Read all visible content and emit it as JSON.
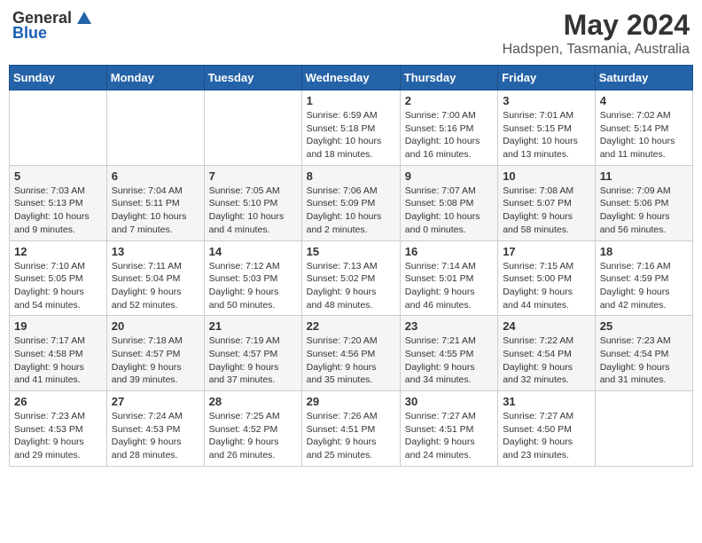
{
  "logo": {
    "general": "General",
    "blue": "Blue"
  },
  "title": {
    "month_year": "May 2024",
    "location": "Hadspen, Tasmania, Australia"
  },
  "weekdays": [
    "Sunday",
    "Monday",
    "Tuesday",
    "Wednesday",
    "Thursday",
    "Friday",
    "Saturday"
  ],
  "weeks": [
    [
      {
        "day": "",
        "info": ""
      },
      {
        "day": "",
        "info": ""
      },
      {
        "day": "",
        "info": ""
      },
      {
        "day": "1",
        "info": "Sunrise: 6:59 AM\nSunset: 5:18 PM\nDaylight: 10 hours\nand 18 minutes."
      },
      {
        "day": "2",
        "info": "Sunrise: 7:00 AM\nSunset: 5:16 PM\nDaylight: 10 hours\nand 16 minutes."
      },
      {
        "day": "3",
        "info": "Sunrise: 7:01 AM\nSunset: 5:15 PM\nDaylight: 10 hours\nand 13 minutes."
      },
      {
        "day": "4",
        "info": "Sunrise: 7:02 AM\nSunset: 5:14 PM\nDaylight: 10 hours\nand 11 minutes."
      }
    ],
    [
      {
        "day": "5",
        "info": "Sunrise: 7:03 AM\nSunset: 5:13 PM\nDaylight: 10 hours\nand 9 minutes."
      },
      {
        "day": "6",
        "info": "Sunrise: 7:04 AM\nSunset: 5:11 PM\nDaylight: 10 hours\nand 7 minutes."
      },
      {
        "day": "7",
        "info": "Sunrise: 7:05 AM\nSunset: 5:10 PM\nDaylight: 10 hours\nand 4 minutes."
      },
      {
        "day": "8",
        "info": "Sunrise: 7:06 AM\nSunset: 5:09 PM\nDaylight: 10 hours\nand 2 minutes."
      },
      {
        "day": "9",
        "info": "Sunrise: 7:07 AM\nSunset: 5:08 PM\nDaylight: 10 hours\nand 0 minutes."
      },
      {
        "day": "10",
        "info": "Sunrise: 7:08 AM\nSunset: 5:07 PM\nDaylight: 9 hours\nand 58 minutes."
      },
      {
        "day": "11",
        "info": "Sunrise: 7:09 AM\nSunset: 5:06 PM\nDaylight: 9 hours\nand 56 minutes."
      }
    ],
    [
      {
        "day": "12",
        "info": "Sunrise: 7:10 AM\nSunset: 5:05 PM\nDaylight: 9 hours\nand 54 minutes."
      },
      {
        "day": "13",
        "info": "Sunrise: 7:11 AM\nSunset: 5:04 PM\nDaylight: 9 hours\nand 52 minutes."
      },
      {
        "day": "14",
        "info": "Sunrise: 7:12 AM\nSunset: 5:03 PM\nDaylight: 9 hours\nand 50 minutes."
      },
      {
        "day": "15",
        "info": "Sunrise: 7:13 AM\nSunset: 5:02 PM\nDaylight: 9 hours\nand 48 minutes."
      },
      {
        "day": "16",
        "info": "Sunrise: 7:14 AM\nSunset: 5:01 PM\nDaylight: 9 hours\nand 46 minutes."
      },
      {
        "day": "17",
        "info": "Sunrise: 7:15 AM\nSunset: 5:00 PM\nDaylight: 9 hours\nand 44 minutes."
      },
      {
        "day": "18",
        "info": "Sunrise: 7:16 AM\nSunset: 4:59 PM\nDaylight: 9 hours\nand 42 minutes."
      }
    ],
    [
      {
        "day": "19",
        "info": "Sunrise: 7:17 AM\nSunset: 4:58 PM\nDaylight: 9 hours\nand 41 minutes."
      },
      {
        "day": "20",
        "info": "Sunrise: 7:18 AM\nSunset: 4:57 PM\nDaylight: 9 hours\nand 39 minutes."
      },
      {
        "day": "21",
        "info": "Sunrise: 7:19 AM\nSunset: 4:57 PM\nDaylight: 9 hours\nand 37 minutes."
      },
      {
        "day": "22",
        "info": "Sunrise: 7:20 AM\nSunset: 4:56 PM\nDaylight: 9 hours\nand 35 minutes."
      },
      {
        "day": "23",
        "info": "Sunrise: 7:21 AM\nSunset: 4:55 PM\nDaylight: 9 hours\nand 34 minutes."
      },
      {
        "day": "24",
        "info": "Sunrise: 7:22 AM\nSunset: 4:54 PM\nDaylight: 9 hours\nand 32 minutes."
      },
      {
        "day": "25",
        "info": "Sunrise: 7:23 AM\nSunset: 4:54 PM\nDaylight: 9 hours\nand 31 minutes."
      }
    ],
    [
      {
        "day": "26",
        "info": "Sunrise: 7:23 AM\nSunset: 4:53 PM\nDaylight: 9 hours\nand 29 minutes."
      },
      {
        "day": "27",
        "info": "Sunrise: 7:24 AM\nSunset: 4:53 PM\nDaylight: 9 hours\nand 28 minutes."
      },
      {
        "day": "28",
        "info": "Sunrise: 7:25 AM\nSunset: 4:52 PM\nDaylight: 9 hours\nand 26 minutes."
      },
      {
        "day": "29",
        "info": "Sunrise: 7:26 AM\nSunset: 4:51 PM\nDaylight: 9 hours\nand 25 minutes."
      },
      {
        "day": "30",
        "info": "Sunrise: 7:27 AM\nSunset: 4:51 PM\nDaylight: 9 hours\nand 24 minutes."
      },
      {
        "day": "31",
        "info": "Sunrise: 7:27 AM\nSunset: 4:50 PM\nDaylight: 9 hours\nand 23 minutes."
      },
      {
        "day": "",
        "info": ""
      }
    ]
  ]
}
